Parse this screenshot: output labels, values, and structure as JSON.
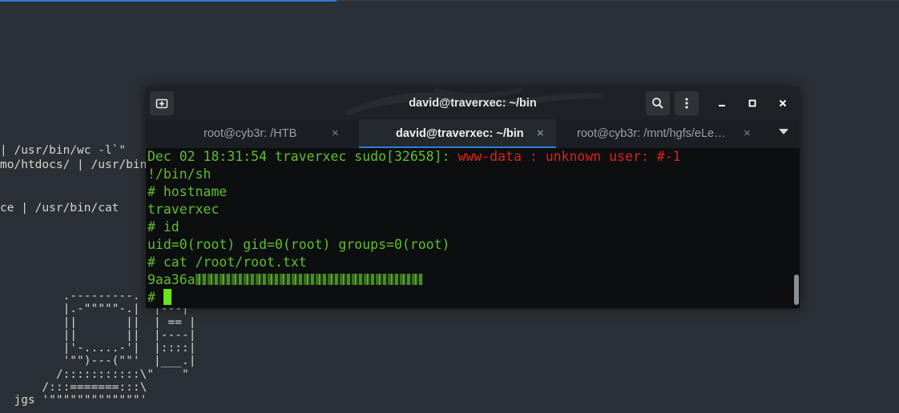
{
  "background_terminal": {
    "lines": [
      "| /usr/bin/wc -l`\"",
      "mo/htdocs/ | /usr/bin",
      "ce | /usr/bin/cat"
    ],
    "ascii_art": [
      "         .---------.  |.---.",
      "         |.-\"\"\"\"\"-.|  |---|",
      "         ||       ||  | == |",
      "         ||       ||  |----|",
      "         |'-.....-'|  |::::|",
      "         '\"\")---(\"\"'  |___.|",
      "        /:::::::::::\\\"    \"",
      "      /:::=======:::\\",
      "  jgs '\"\"\"\"\"\"\"\"\"\"\"\"\"'"
    ]
  },
  "window": {
    "title": "david@traverxec: ~/bin",
    "icons": {
      "new_tab": "new-tab-icon",
      "search": "search-icon",
      "menu": "kebab-menu-icon",
      "minimize": "minimize-icon",
      "maximize": "maximize-icon",
      "close": "close-icon"
    },
    "tabs": [
      {
        "label": "root@cyb3r: /HTB",
        "close": "×",
        "active": false
      },
      {
        "label": "david@traverxec: ~/bin",
        "close": "×",
        "active": true
      },
      {
        "label": "root@cyb3r: /mnt/hgfs/eLe…",
        "close": "×",
        "active": false
      }
    ],
    "colors": {
      "accent": "#2f7dd6",
      "terminal_green": "#5fbf2a",
      "terminal_red": "#e0201a",
      "cursor": "#6be31f"
    }
  },
  "terminal": {
    "log_prefix": "Dec 02 18:31:54 traverxec sudo[32658]: ",
    "log_error": "www-data : unknown user: #-1",
    "lines": [
      "!/bin/sh",
      "# hostname",
      "traverxec",
      "# id",
      "uid=0(root) gid=0(root) groups=0(root)",
      "# cat /root/root.txt"
    ],
    "flag_visible": "9aa36a",
    "prompt": "# "
  }
}
